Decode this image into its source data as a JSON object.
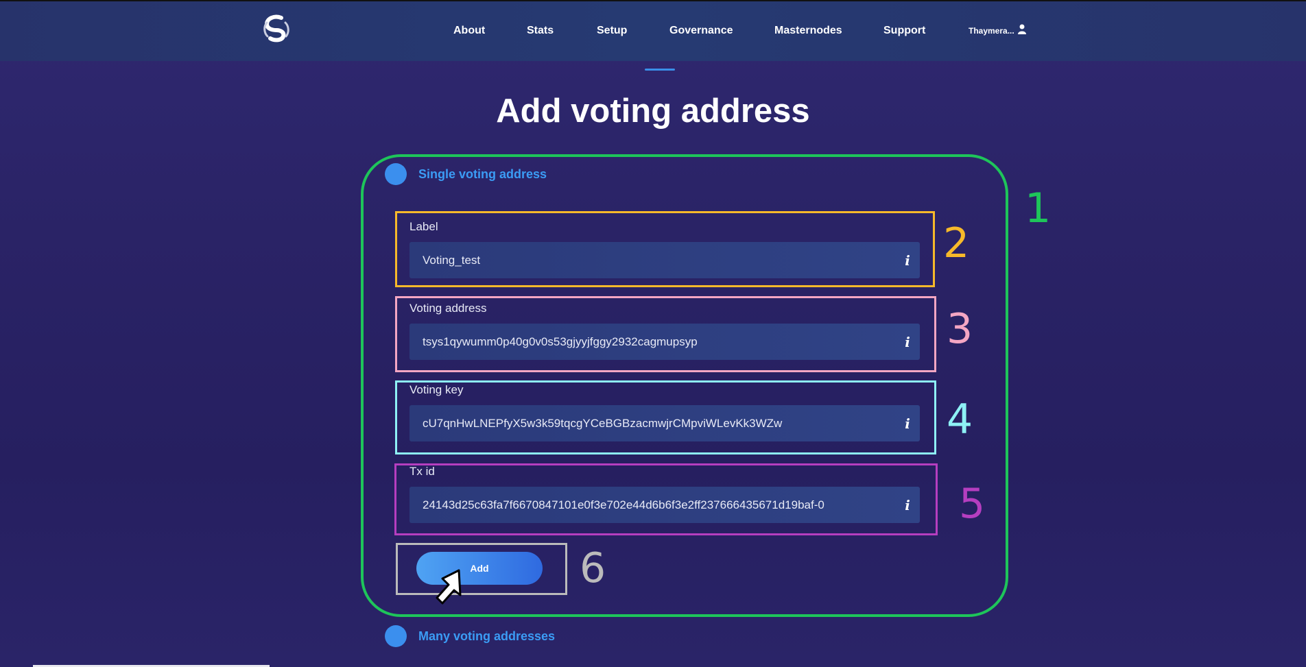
{
  "nav": {
    "logo": "syscoin-logo",
    "items": [
      "About",
      "Stats",
      "Setup",
      "Governance",
      "Masternodes",
      "Support"
    ],
    "user": "Thaymera...",
    "user_icon": "user-icon"
  },
  "page": {
    "title": "Add voting address"
  },
  "options": {
    "single": "Single voting address",
    "many": "Many voting addresses"
  },
  "form": {
    "label": {
      "label": "Label",
      "value": "Voting_test"
    },
    "voting_address": {
      "label": "Voting address",
      "value": "tsys1qywumm0p40g0v0s53gjyyjfggy2932cagmupsyp"
    },
    "voting_key": {
      "label": "Voting key",
      "value": "cU7qnHwLNEPfyX5w3k59tqcgYCeBGBzacmwjrCMpviWLevKk3WZw"
    },
    "tx_id": {
      "label": "Tx id",
      "value": "24143d25c63fa7f6670847101e0f3e702e44d6b6f3e2ff237666435671d19baf-0"
    },
    "info_icon_glyph": "i",
    "add_label": "Add"
  },
  "annotations": {
    "numbers": [
      "1",
      "2",
      "3",
      "4",
      "5",
      "6"
    ],
    "colors": [
      "#1ec55a",
      "#f7b92a",
      "#f4a6c3",
      "#8ef1f5",
      "#b63ec0",
      "#bbbbbb"
    ]
  },
  "colors": {
    "accent": "#3b8fee",
    "link": "#3b9cf5"
  }
}
